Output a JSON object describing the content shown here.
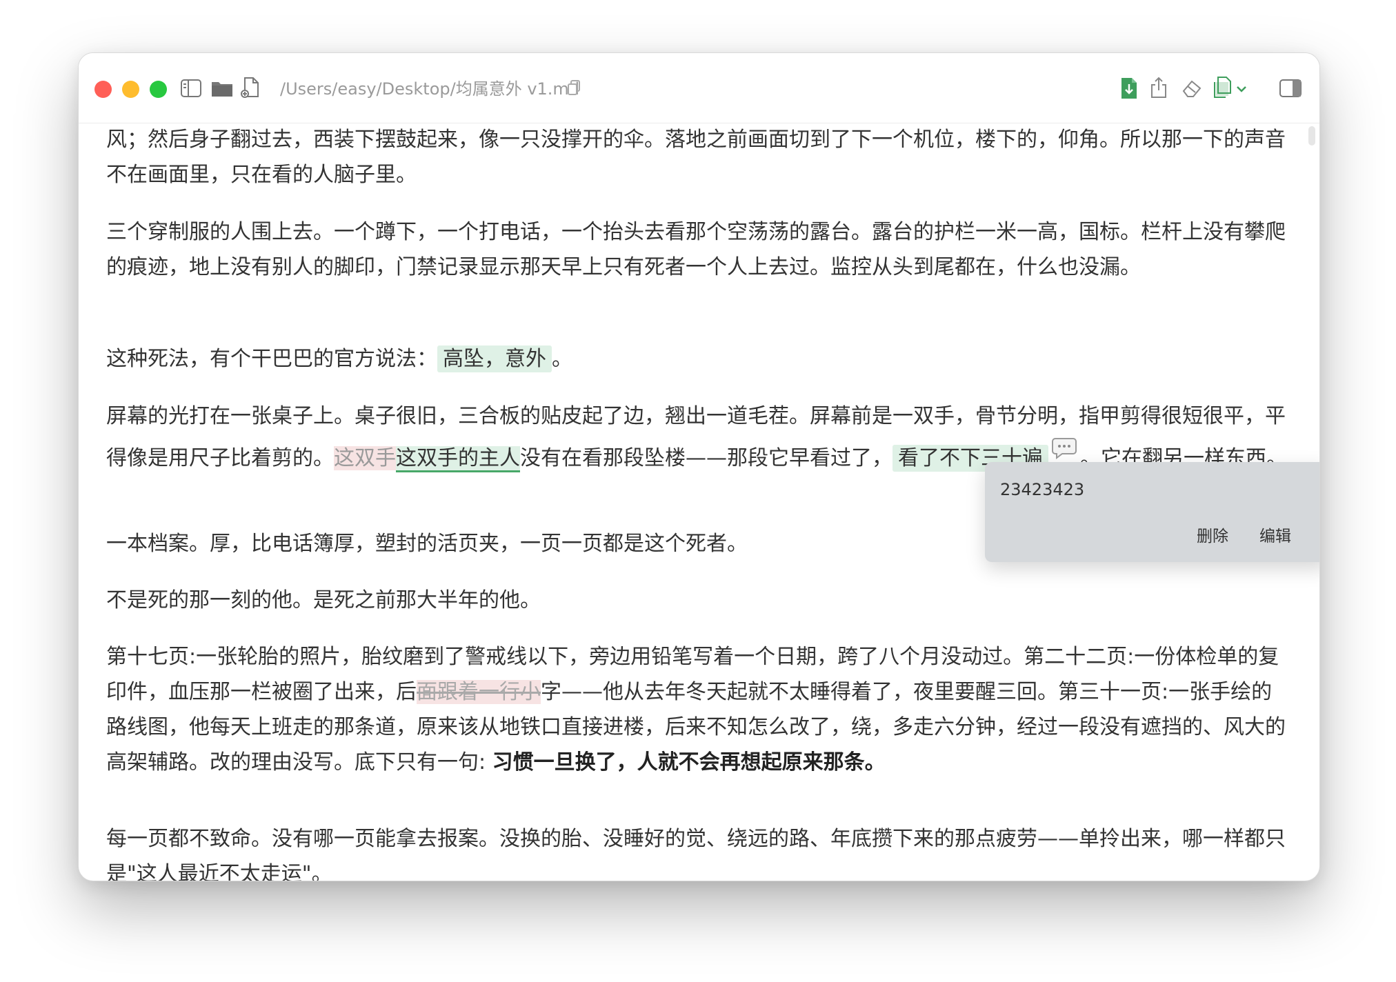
{
  "window": {
    "path": "/Users/easy/Desktop/均属意外 v1.md"
  },
  "icons": {
    "sidebar": "sidebar-icon",
    "folder": "folder-icon",
    "new_file": "new-file-icon",
    "copy_path": "copy-icon",
    "export": "export-file-icon",
    "share": "share-icon",
    "eraser": "eraser-icon",
    "copy_menu": "copy-menu-icon",
    "right_panel": "right-panel-icon",
    "comment": "comment-bubble-icon"
  },
  "colors": {
    "accent_green": "#48a868",
    "highlight_green": "#dff1e6",
    "highlight_red": "#f7e3e3",
    "popup_bg": "#d5d8db"
  },
  "document": {
    "p1": "风；然后身子翻过去，西装下摆鼓起来，像一只没撑开的伞。落地之前画面切到了下一个机位，楼下的，仰角。所以那一下的声音不在画面里，只在看的人脑子里。",
    "p2": "三个穿制服的人围上去。一个蹲下，一个打电话，一个抬头去看那个空荡荡的露台。露台的护栏一米一高，国标。栏杆上没有攀爬的痕迹，地上没有别人的脚印，门禁记录显示那天早上只有死者一个人上去过。监控从头到尾都在，什么也没漏。",
    "p3_a": "这种死法，有个干巴巴的官方说法：",
    "p3_hl": "高坠，意外",
    "p3_b": "。",
    "p4_a": "屏幕的光打在一张桌子上。桌子很旧，三合板的贴皮起了边，翘出一道毛茬。屏幕前是一双手，骨节分明，指甲剪得很短很平，平得像是用尺子比着剪的。",
    "p4_del": "这双手",
    "p4_ins": "这双手的主人",
    "p4_b": "没有在看那段坠楼——那段它早看过了，",
    "p4_hl": "看了不下三十遍",
    "p4_c": "。它在翻另一样东西。",
    "p5": "一本档案。厚，比电话簿厚，塑封的活页夹，一页一页都是这个死者。",
    "p6": "不是死的那一刻的他。是死之前那大半年的他。",
    "p7_a": "第十七页:一张轮胎的照片，胎纹磨到了警戒线以下，旁边用铅笔写着一个日期，跨了八个月没动过。第二十二页:一份体检单的复印件，血压那一栏被圈了出来，后",
    "p7_del": "面跟着一行小",
    "p7_b": "字——他从去年冬天起就不太睡得着了，夜里要醒三回。第三十一页:一张手绘的路线图，他每天上班走的那条道，原来该从地铁口直接进楼，后来不知怎么改了，绕，多走六分钟，经过一段没有遮挡的、风大的高架辅路。改的理由没写。底下只有一句: ",
    "p7_bold": "习惯一旦换了，人就不会再想起原来那条。",
    "p8": "每一页都不致命。没有哪一页能拿去报案。没换的胎、没睡好的觉、绕远的路、年底攒下来的那点疲劳——单拎出来，哪一样都只是\"这人最近不太走运\"。"
  },
  "comment_popup": {
    "text": "23423423",
    "delete_label": "删除",
    "edit_label": "编辑"
  }
}
